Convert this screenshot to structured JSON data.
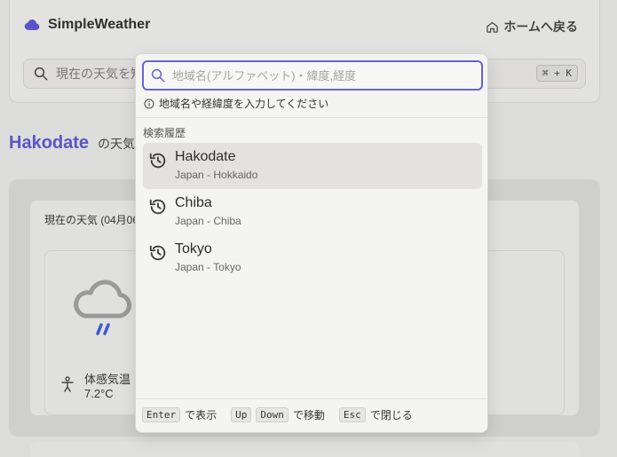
{
  "header": {
    "app_name": "SimpleWeather",
    "home_link": "ホームへ戻る"
  },
  "background_search": {
    "placeholder": "現在の天気を知",
    "shortcut": "⌘ + K"
  },
  "location": {
    "name": "Hakodate",
    "subtitle": "の天気"
  },
  "weather": {
    "date_label": "現在の天気 (04月06",
    "feels_label": "体感気温",
    "feels_value": "7.2°C"
  },
  "palette": {
    "placeholder": "地域名(アルファベット)・緯度,経度",
    "hint": "地域名や経緯度を入力してください",
    "section_label": "検索履歴",
    "history": [
      {
        "name": "Hakodate",
        "region": "Japan - Hokkaido",
        "icon": "history-icon"
      },
      {
        "name": "Chiba",
        "region": "Japan - Chiba",
        "icon": "history-icon"
      },
      {
        "name": "Tokyo",
        "region": "Japan - Tokyo",
        "icon": "history-icon"
      }
    ],
    "footer": {
      "enter_key": "Enter",
      "enter_label": "で表示",
      "up_key": "Up",
      "down_key": "Down",
      "move_label": "で移動",
      "esc_key": "Esc",
      "esc_label": "で閉じる"
    }
  },
  "colors": {
    "accent": "#5b54c9",
    "focus_border": "#6a62d6",
    "rain": "#3a5bd0"
  }
}
